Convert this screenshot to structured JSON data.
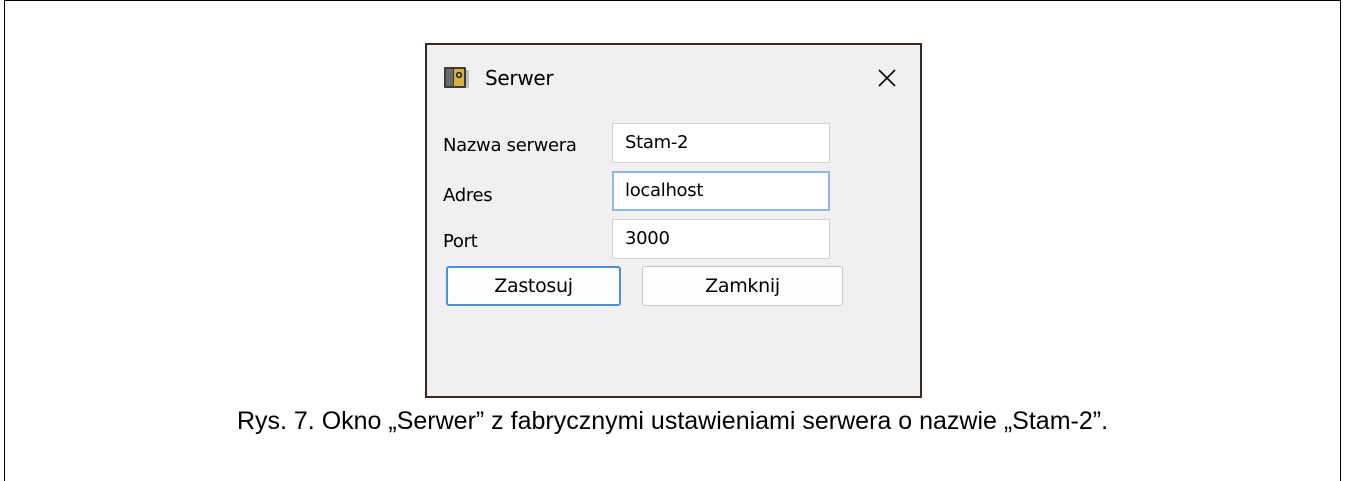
{
  "dialog": {
    "title": "Serwer",
    "icon": "server-app-icon",
    "close_icon": "close-icon",
    "fields": [
      {
        "label": "Nazwa serwera",
        "value": "Stam-2"
      },
      {
        "label": "Adres",
        "value": "localhost"
      },
      {
        "label": "Port",
        "value": "3000"
      }
    ],
    "buttons": {
      "apply_label": "Zastosuj",
      "close_label": "Zamknij"
    }
  },
  "caption": "Rys. 7. Okno „Serwer” z fabrycznymi ustawieniami serwera o nazwie „Stam-2”.",
  "colors": {
    "dialog_border": "#3b2a21",
    "dialog_bg": "#f0f0f0",
    "focus_accent": "#8fb8e6",
    "primary_button_border": "#4a90d9"
  }
}
